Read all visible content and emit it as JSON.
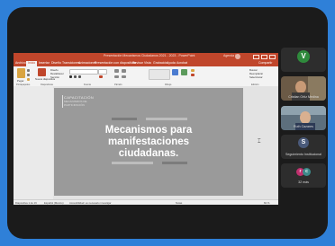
{
  "powerpoint": {
    "window_title": "Presentación Mecanismos Ciudadanos 2021 - 2023 - PowerPoint",
    "user_name": "Agenda Sol",
    "menu_tabs": [
      "Archivo",
      "Inicio",
      "Insertar",
      "Diseño",
      "Transiciones",
      "Animaciones",
      "Presentación con diapositivas",
      "Revisar",
      "Vista",
      "Grabación",
      "Ayuda",
      "Acrobat"
    ],
    "active_tab_index": 1,
    "share_label": "Compartir",
    "ribbon_groups": [
      "Portapapeles",
      "Diapositivas",
      "Fuente",
      "Párrafo",
      "Dibujo",
      "Edición"
    ],
    "ribbon_items": {
      "pegar": "Pegar",
      "nueva": "Nueva diapositiva",
      "diseno": "Diseño",
      "restablecer": "Restablecer",
      "seccion": "Sección",
      "buscar": "Buscar",
      "reemplazar": "Reemplazar",
      "seleccionar": "Seleccionar"
    },
    "slide": {
      "brand_line1": "CAPACITACIÓN",
      "brand_line2": "MECANISMOS DE",
      "brand_line3": "PARTICIPACIÓN",
      "title": "Mecanismos para manifestaciones ciudadanas.",
      "bar_color_dark": "#7c7c7c",
      "bar_color_light": "#bdbdbd"
    },
    "status": {
      "slide_count": "Diapositiva 1 de 16",
      "language": "Español (México)",
      "accessibility": "Accesibilidad: es necesario investigar",
      "notes": "Notas",
      "zoom": "84 %"
    }
  },
  "participants": [
    {
      "name": "",
      "initial": "V",
      "color": "#2f8a3c",
      "type": "avatar"
    },
    {
      "name": "Cristian Ortiz Medina",
      "type": "video"
    },
    {
      "name": "Ruth Cazares",
      "type": "video"
    },
    {
      "name": "Seguimiento Institucional",
      "initial": "S",
      "color": "#4a5a7a",
      "type": "avatar"
    },
    {
      "name": "32 más",
      "type": "more"
    }
  ],
  "colors": {
    "background": "#2f80d8",
    "frame": "#1b1b1b",
    "ppt_accent": "#c0462b",
    "slide_bg": "#9a9a9a"
  }
}
